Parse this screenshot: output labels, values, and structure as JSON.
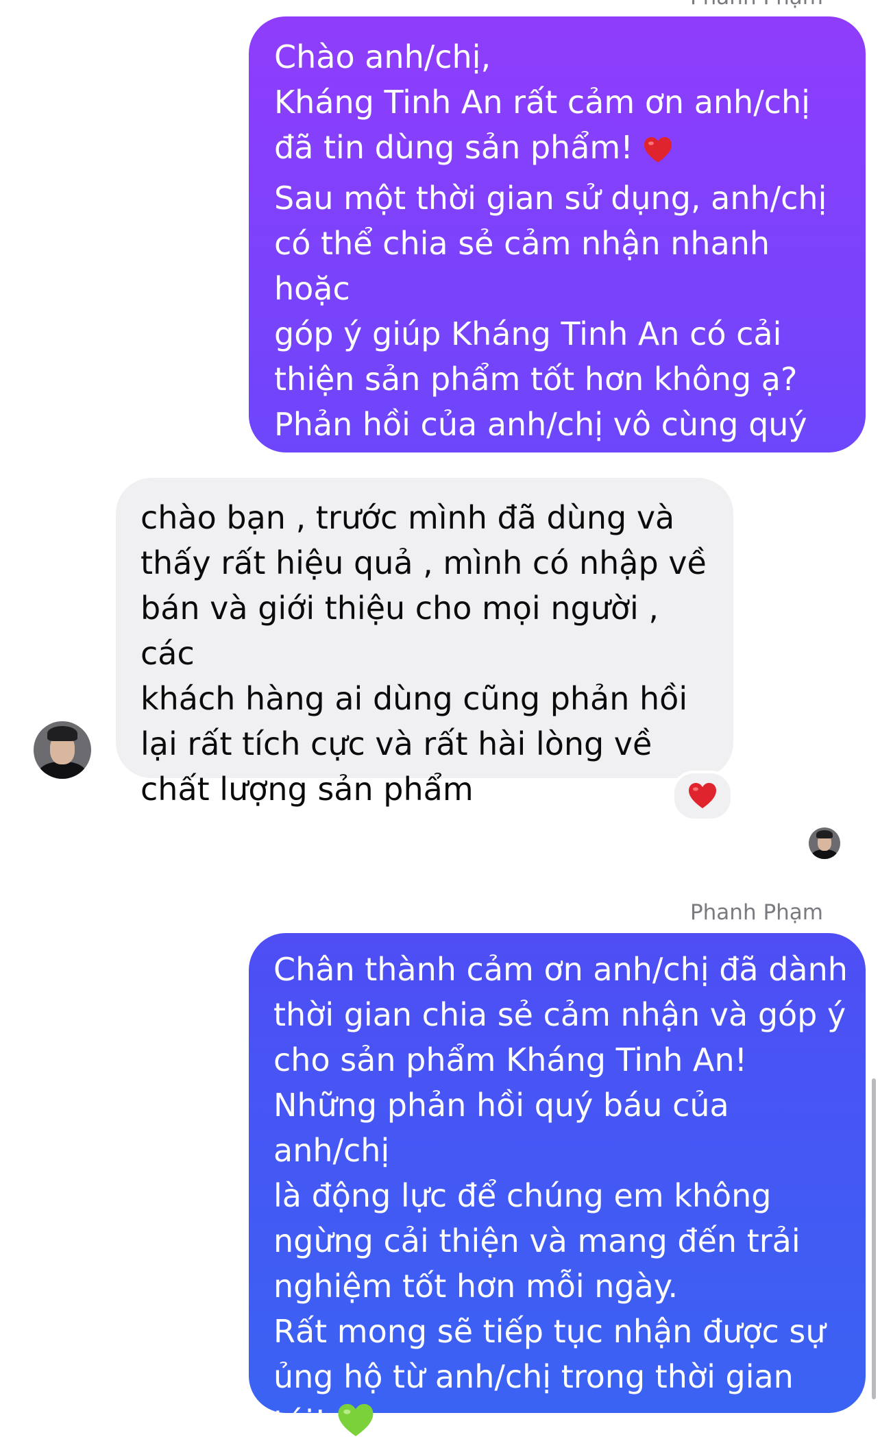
{
  "messages": [
    {
      "sender": "Phanh Phạm",
      "direction": "outgoing",
      "text": "Chào anh/chị,\nKháng Tinh An rất cảm ơn anh/chị\nđã tin dùng sản phẩm!",
      "text_after_emoji": "\nSau một thời gian sử dụng, anh/chị\ncó thể chia sẻ cảm nhận nhanh hoặc\ngóp ý giúp Kháng Tinh An có cải\nthiện sản phẩm tốt hơn không ạ?\nPhản hồi của anh/chị vô cùng quý\ngiá với chúng tôi",
      "emoji": "red-heart"
    },
    {
      "direction": "incoming",
      "text": "chào bạn , trước mình đã dùng và\nthấy rất hiệu quả , mình có nhập về\nbán và giới thiệu cho mọi người , các\nkhách hàng ai dùng cũng phản hồi\nlại rất tích cực và rất hài lòng về\nchất lượng sản phẩm",
      "reaction": "red-heart"
    },
    {
      "sender": "Phanh Phạm",
      "direction": "outgoing",
      "text": "Chân thành cảm ơn anh/chị đã dành\nthời gian chia sẻ cảm nhận và góp ý\ncho sản phẩm Kháng Tinh An!\nNhững phản hồi quý báu của anh/chị\nlà động lực để chúng em không\nngừng cải thiện và mang đến trải\nnghiệm tốt hơn mỗi ngày.\nRất mong sẽ tiếp tục nhận được sự\nủng hộ từ anh/chị trong thời gian\ntới!",
      "emoji": "green-heart"
    }
  ],
  "colors": {
    "outgoing_1": "#8f3dfb",
    "outgoing_2": "#4e4ef4",
    "incoming": "#f0f0f2",
    "red_heart": "#e0242e",
    "green_heart": "#7ad13a"
  }
}
